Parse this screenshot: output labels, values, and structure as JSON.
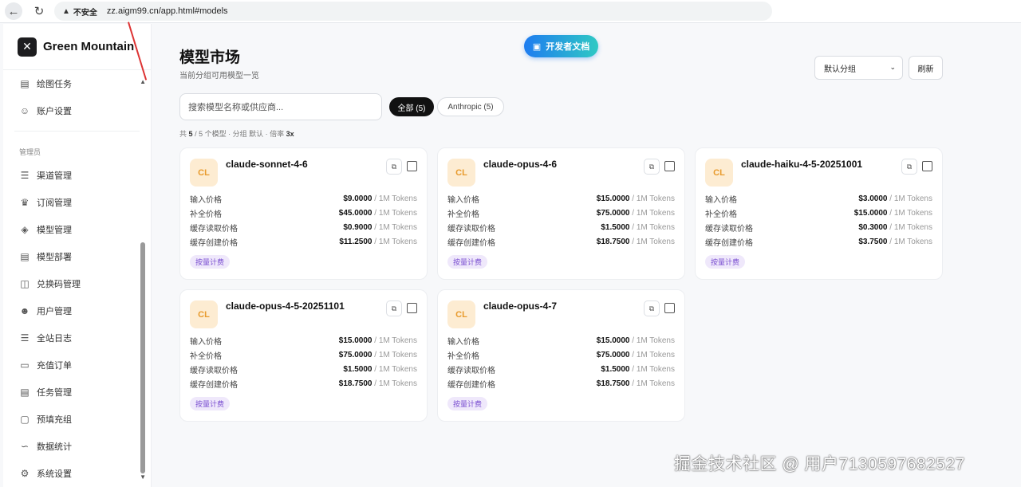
{
  "browser": {
    "insecure_label": "不安全",
    "url": "zz.aigm99.cn/app.html#models"
  },
  "sidebar": {
    "brand": "Green Mountain",
    "items_top": [
      {
        "label": "绘图任务",
        "icon": "image-icon"
      },
      {
        "label": "账户设置",
        "icon": "user-icon"
      }
    ],
    "section_label": "管理员",
    "items_admin": [
      {
        "label": "渠道管理",
        "icon": "sliders-icon"
      },
      {
        "label": "订阅管理",
        "icon": "crown-icon"
      },
      {
        "label": "模型管理",
        "icon": "layers-icon"
      },
      {
        "label": "模型部署",
        "icon": "server-icon"
      },
      {
        "label": "兑换码管理",
        "icon": "gift-icon"
      },
      {
        "label": "用户管理",
        "icon": "users-icon"
      },
      {
        "label": "全站日志",
        "icon": "list-icon"
      },
      {
        "label": "充值订单",
        "icon": "card-icon"
      },
      {
        "label": "任务管理",
        "icon": "image-icon"
      },
      {
        "label": "预填充组",
        "icon": "clipboard-icon"
      },
      {
        "label": "数据统计",
        "icon": "chart-icon"
      },
      {
        "label": "系统设置",
        "icon": "gear-icon"
      }
    ]
  },
  "header": {
    "title": "模型市场",
    "subtitle": "当前分组可用模型一览",
    "dev_doc_button": "开发者文档",
    "group_select": "默认分组",
    "refresh_button": "刷新"
  },
  "filters": {
    "search_placeholder": "搜索模型名称或供应商...",
    "chip_all": "全部 (5)",
    "chip_anthropic": "Anthropic (5)"
  },
  "summary": {
    "prefix": "共",
    "shown": "5",
    "sep": "/",
    "total_text": "5 个模型 · 分组",
    "group": "默认",
    "rate_label": "· 倍率",
    "rate": "3x"
  },
  "price_labels": [
    "输入价格",
    "补全价格",
    "缓存读取价格",
    "缓存创建价格"
  ],
  "price_unit": "/ 1M Tokens",
  "billing_tag": "按量计费",
  "models": [
    {
      "avatar": "CL",
      "name": "claude-sonnet-4-6",
      "prices": [
        "$9.0000",
        "$45.0000",
        "$0.9000",
        "$11.2500"
      ]
    },
    {
      "avatar": "CL",
      "name": "claude-opus-4-6",
      "prices": [
        "$15.0000",
        "$75.0000",
        "$1.5000",
        "$18.7500"
      ]
    },
    {
      "avatar": "CL",
      "name": "claude-haiku-4-5-20251001",
      "prices": [
        "$3.0000",
        "$15.0000",
        "$0.3000",
        "$3.7500"
      ]
    },
    {
      "avatar": "CL",
      "name": "claude-opus-4-5-20251101",
      "prices": [
        "$15.0000",
        "$75.0000",
        "$1.5000",
        "$18.7500"
      ]
    },
    {
      "avatar": "CL",
      "name": "claude-opus-4-7",
      "prices": [
        "$15.0000",
        "$75.0000",
        "$1.5000",
        "$18.7500"
      ]
    }
  ],
  "watermark": "掘金技术社区 @ 用户7130597682527"
}
